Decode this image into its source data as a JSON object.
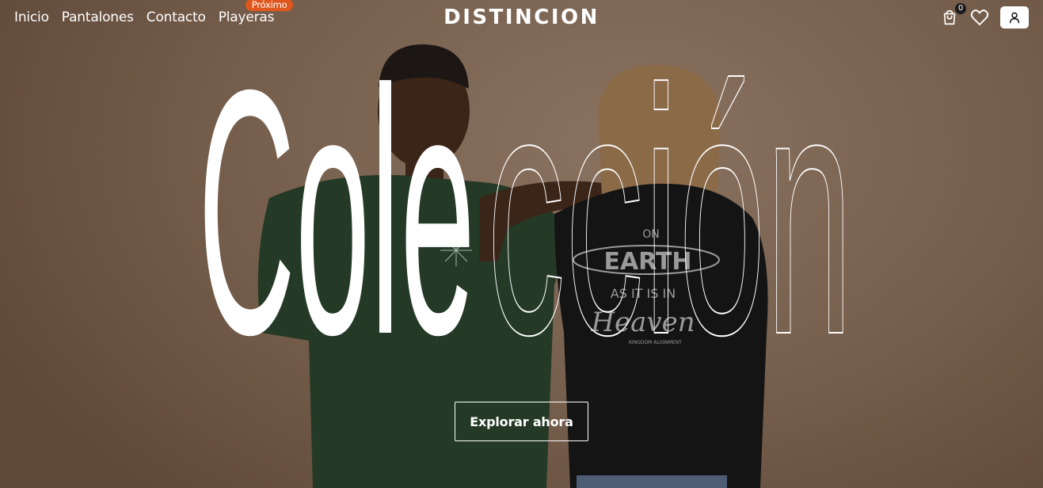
{
  "header": {
    "nav": [
      {
        "label": "Inicio"
      },
      {
        "label": "Pantalones"
      },
      {
        "label": "Contacto"
      },
      {
        "label": "Playeras",
        "badge": "Próximo"
      }
    ],
    "brand": "DISTINCION",
    "cart_count": "0",
    "icons": [
      "cart-icon",
      "heart-icon",
      "user-icon"
    ]
  },
  "hero": {
    "headline_solid": "Cole",
    "headline_outline": "cción",
    "cta_label": "Explorar ahora",
    "shirt_print": {
      "line1": "ON",
      "line2": "EARTH",
      "line3": "AS IT IS IN",
      "line4": "Heaven",
      "small_left": "KINGDOM ALIGNMENT"
    }
  },
  "colors": {
    "background": "#7a6351",
    "badge": "#e0571d",
    "text": "#ffffff",
    "green_shirt": "#243a26",
    "black_shirt": "#141414"
  }
}
